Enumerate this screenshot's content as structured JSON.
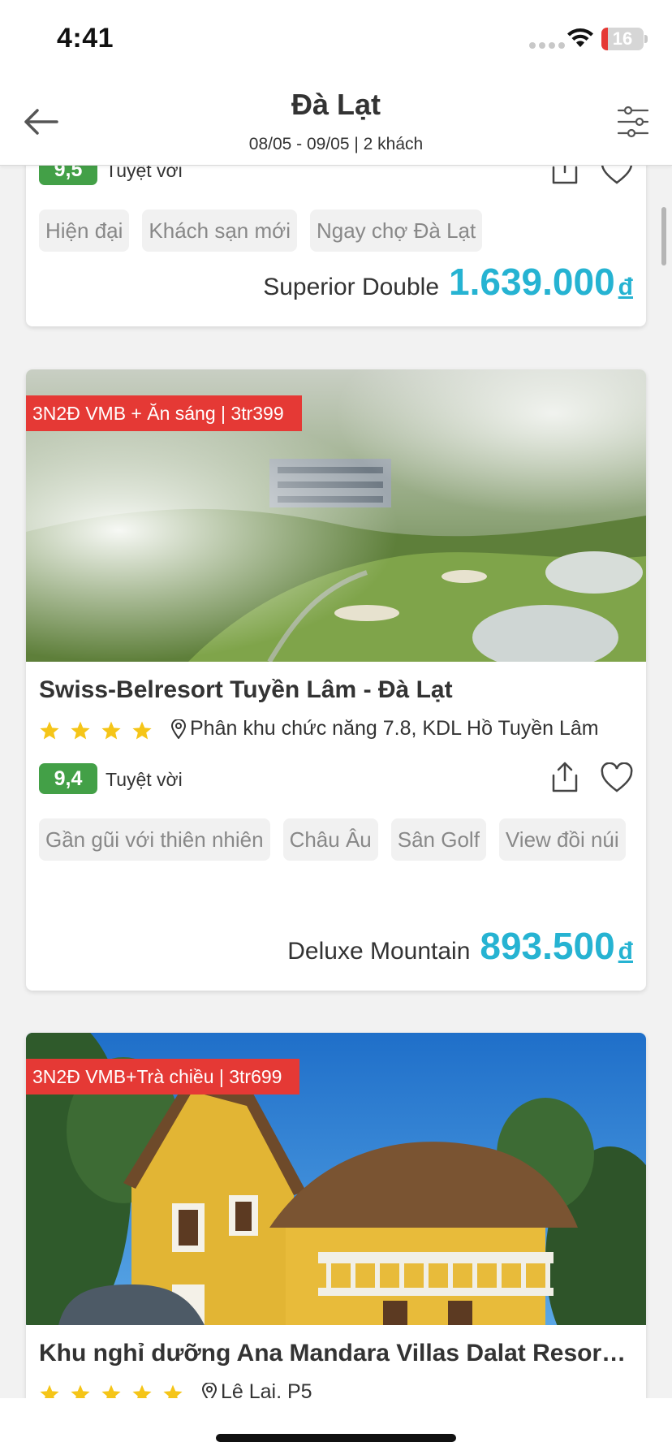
{
  "status_bar": {
    "time": "4:41",
    "battery": "16",
    "battery_level_fraction": 0.16
  },
  "header": {
    "title": "Đà Lạt",
    "subtitle": "08/05 - 09/05 | 2 khách"
  },
  "hotels": [
    {
      "rating": "9,5",
      "rating_text": "Tuyệt vời",
      "tags": [
        "Hiện đại",
        "Khách sạn mới",
        "Ngay chợ Đà Lạt"
      ],
      "room_type": "Superior Double",
      "price": "1.639.000",
      "currency": "đ"
    },
    {
      "promo": "3N2Đ VMB + Ăn sáng | 3tr399",
      "name": "Swiss-Belresort Tuyền Lâm - Đà Lạt",
      "star_count": 4,
      "address": "Phân khu chức năng 7.8, KDL Hồ Tuyền Lâm",
      "rating": "9,4",
      "rating_text": "Tuyệt vời",
      "tags": [
        "Gần gũi với thiên nhiên",
        "Châu Âu",
        "Sân Golf",
        "View đồi núi"
      ],
      "room_type": "Deluxe Mountain",
      "price": "893.500",
      "currency": "đ"
    },
    {
      "promo": "3N2Đ VMB+Trà chiều | 3tr699",
      "name": "Khu nghỉ dưỡng Ana Mandara Villas Dalat Resor…",
      "star_count": 5,
      "address": "Lê Lai, P5"
    }
  ],
  "colors": {
    "price": "#26b3d2",
    "rating_badge": "#43a047",
    "promo": "#e53935",
    "star": "#f5c518"
  }
}
